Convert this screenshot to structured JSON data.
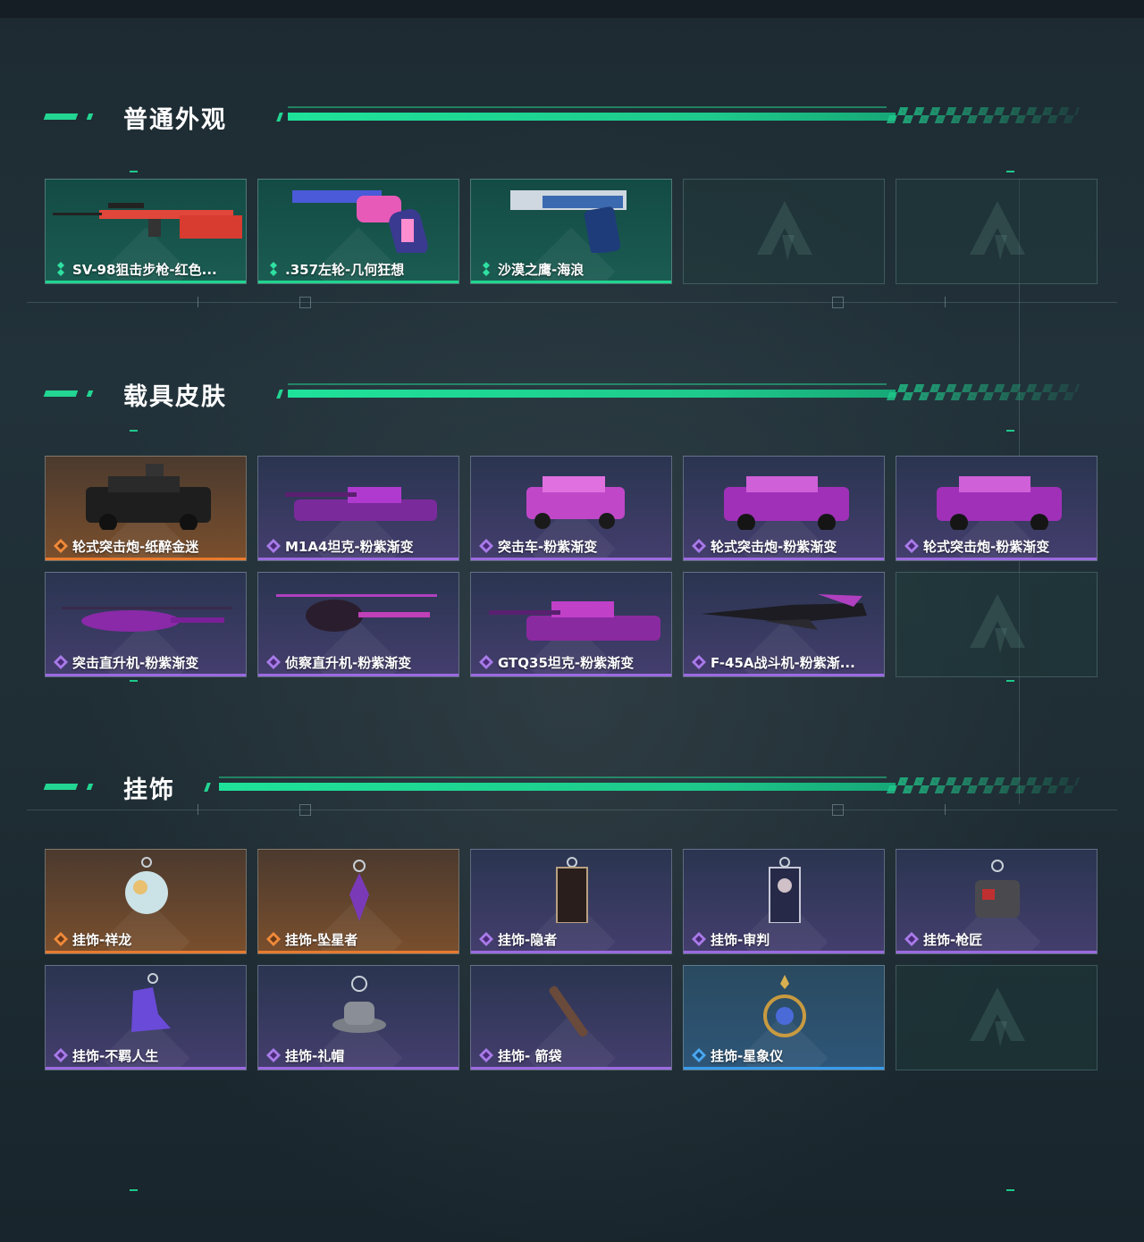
{
  "colors": {
    "accent": "#23d592",
    "rarity_green": "#21d48f",
    "rarity_orange": "#e87a2e",
    "rarity_purple": "#9b6ae0",
    "rarity_blue": "#3a9be8"
  },
  "sections": [
    {
      "title": "普通外观",
      "items": [
        {
          "name": "SV-98狙击步枪-红色...",
          "rarity": "green",
          "icon": "rifle-icon"
        },
        {
          "name": ".357左轮-几何狂想",
          "rarity": "green",
          "icon": "revolver-icon"
        },
        {
          "name": "沙漠之鹰-海浪",
          "rarity": "green",
          "icon": "pistol-icon"
        },
        {
          "empty": true
        },
        {
          "empty": true
        }
      ]
    },
    {
      "title": "载具皮肤",
      "items": [
        {
          "name": "轮式突击炮-纸醉金迷",
          "rarity": "orange",
          "icon": "armored-car-icon"
        },
        {
          "name": "M1A4坦克-粉紫渐变",
          "rarity": "purple",
          "icon": "tank-icon"
        },
        {
          "name": "突击车-粉紫渐变",
          "rarity": "purple",
          "icon": "assault-vehicle-icon"
        },
        {
          "name": "轮式突击炮-粉紫渐变",
          "rarity": "purple",
          "icon": "armored-car-icon"
        },
        {
          "name": "轮式突击炮-粉紫渐变",
          "rarity": "purple",
          "icon": "armored-car-icon"
        },
        {
          "name": "突击直升机-粉紫渐变",
          "rarity": "purple",
          "icon": "attack-helicopter-icon"
        },
        {
          "name": "侦察直升机-粉紫渐变",
          "rarity": "purple",
          "icon": "scout-helicopter-icon"
        },
        {
          "name": "GTQ35坦克-粉紫渐变",
          "rarity": "purple",
          "icon": "tank-icon"
        },
        {
          "name": "F-45A战斗机-粉紫渐...",
          "rarity": "purple",
          "icon": "fighter-jet-icon"
        },
        {
          "empty": true
        }
      ]
    },
    {
      "title": "挂饰",
      "items": [
        {
          "name": "挂饰-祥龙",
          "rarity": "orange",
          "icon": "dragon-charm-icon"
        },
        {
          "name": "挂饰-坠星者",
          "rarity": "orange",
          "icon": "crystal-charm-icon"
        },
        {
          "name": "挂饰-隐者",
          "rarity": "purple",
          "icon": "card-charm-icon"
        },
        {
          "name": "挂饰-审判",
          "rarity": "purple",
          "icon": "card-charm-icon"
        },
        {
          "name": "挂饰-枪匠",
          "rarity": "purple",
          "icon": "vest-charm-icon"
        },
        {
          "name": "挂饰-不羁人生",
          "rarity": "purple",
          "icon": "sneaker-charm-icon"
        },
        {
          "name": "挂饰-礼帽",
          "rarity": "purple",
          "icon": "hat-charm-icon"
        },
        {
          "name": "挂饰- 箭袋",
          "rarity": "purple",
          "icon": "quiver-charm-icon"
        },
        {
          "name": "挂饰-星象仪",
          "rarity": "blue",
          "icon": "astrolabe-charm-icon"
        },
        {
          "empty": true
        }
      ]
    }
  ]
}
